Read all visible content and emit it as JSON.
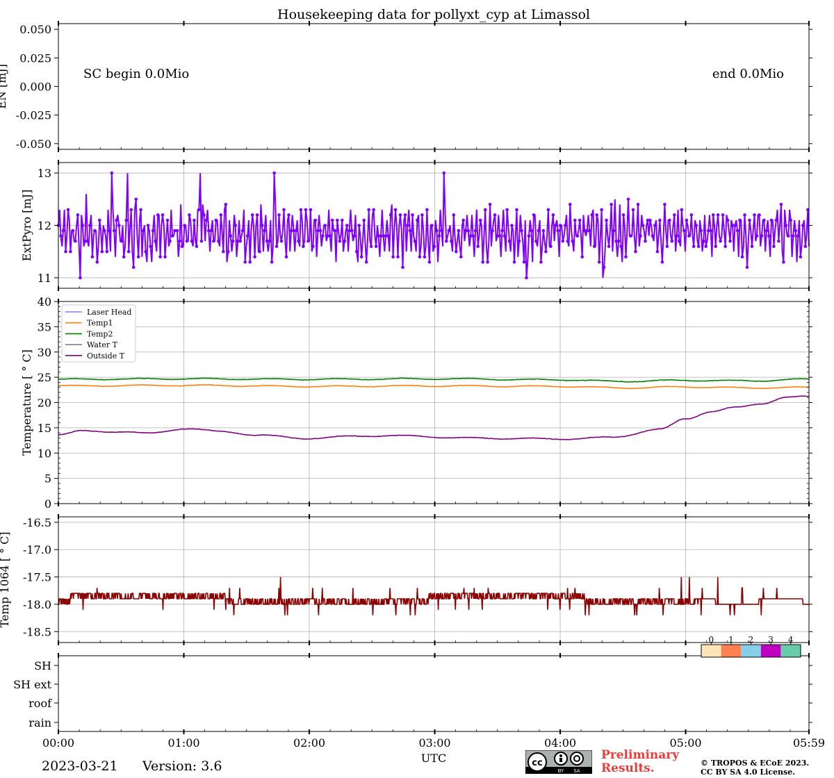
{
  "footer": {
    "date": "2023-03-21",
    "version": "Version: 3.6",
    "preliminary_line1": "Preliminary",
    "preliminary_line2": "Results.",
    "copyright_line1": "© TROPOS & ECoE 2023.",
    "copyright_line2": "CC BY SA 4.0 License.",
    "license_badge": "cc-by-sa-icon"
  },
  "chart_data": {
    "type": "line",
    "title": "Housekeeping data for pollyxt_cyp at Limassol",
    "xlabel": "UTC",
    "x_ticks": [
      "00:00",
      "01:00",
      "02:00",
      "03:00",
      "04:00",
      "05:00",
      "05:59"
    ],
    "x_range_hours": [
      0,
      5.983
    ],
    "grid": true,
    "panels": [
      {
        "id": "energy",
        "ylabel": "EN [mJ]",
        "ylim": [
          -0.055,
          0.055
        ],
        "yticks": [
          "0.050",
          "0.025",
          "0.000",
          "-0.025",
          "-0.050"
        ],
        "ytick_values": [
          0.05,
          0.025,
          0.0,
          -0.025,
          -0.05
        ],
        "annotations": [
          "SC begin 0.0Mio",
          "end 0.0Mio"
        ],
        "series": []
      },
      {
        "id": "extpyro",
        "ylabel": "ExtPyro [mJ]",
        "ylim": [
          10.8,
          13.2
        ],
        "yticks": [
          "13",
          "12",
          "11"
        ],
        "ytick_values": [
          13,
          12,
          11
        ],
        "series": [
          {
            "name": "ExtPyro",
            "color": "#7f00ff",
            "marker": "dot",
            "mean": 11.85,
            "min": 10.9,
            "max": 13.1
          }
        ]
      },
      {
        "id": "temperature",
        "ylabel": "Temperature [$^\\circ C$]",
        "ylim": [
          0,
          40
        ],
        "yticks": [
          "40",
          "35",
          "30",
          "25",
          "20",
          "15",
          "10",
          "5",
          "0"
        ],
        "ytick_values": [
          40,
          35,
          30,
          25,
          20,
          15,
          10,
          5,
          0
        ],
        "legend_position": "upper-left",
        "series": [
          {
            "name": "Laser Head",
            "color": "#7b7bff",
            "x": [],
            "y": []
          },
          {
            "name": "Temp1",
            "color": "#ff7f0e",
            "x": [
              0,
              1,
              2,
              3,
              4,
              4.5,
              5,
              5.5,
              5.98
            ],
            "y": [
              23.3,
              23.4,
              23.2,
              23.3,
              23.2,
              22.9,
              23.1,
              22.9,
              23.0
            ]
          },
          {
            "name": "Temp2",
            "color": "#008000",
            "x": [
              0,
              1,
              2,
              3,
              4,
              4.5,
              5,
              5.5,
              5.98
            ],
            "y": [
              24.6,
              24.7,
              24.6,
              24.7,
              24.5,
              24.2,
              24.4,
              24.3,
              24.6
            ]
          },
          {
            "name": "Water T",
            "color": "#808080",
            "x": [],
            "y": []
          },
          {
            "name": "Outside T",
            "color": "#800080",
            "x": [
              0,
              0.2,
              0.5,
              0.7,
              1.0,
              1.3,
              1.6,
              2.0,
              2.4,
              2.8,
              3.2,
              3.6,
              4.0,
              4.4,
              4.8,
              5.0,
              5.2,
              5.4,
              5.6,
              5.8,
              5.98
            ],
            "y": [
              13.6,
              14.4,
              14.2,
              13.9,
              14.8,
              14.3,
              13.5,
              12.9,
              13.4,
              13.4,
              13.0,
              12.9,
              12.8,
              13.1,
              14.7,
              16.8,
              18.2,
              19.0,
              19.8,
              21.0,
              21.2
            ]
          }
        ]
      },
      {
        "id": "temp1064",
        "ylabel": "Temp 1064 [$^\\circ C$]",
        "ylim": [
          -18.7,
          -16.4
        ],
        "yticks": [
          "-16.5",
          "-17.0",
          "-17.5",
          "-18.0",
          "-18.5"
        ],
        "ytick_values": [
          -16.5,
          -17.0,
          -17.5,
          -18.0,
          -18.5
        ],
        "series": [
          {
            "name": "Temp 1064",
            "color": "#8b0000",
            "step": true,
            "levels": [
              -17.8,
              -17.9,
              -18.0,
              -18.1
            ],
            "min": -18.3,
            "max": -17.5
          }
        ]
      },
      {
        "id": "status",
        "ylabel": "",
        "categories": [
          "SH",
          "SH ext",
          "roof",
          "rain"
        ],
        "colorbar_labels": [
          "0",
          "1",
          "2",
          "3",
          "4"
        ],
        "colorbar_colors": [
          "#ffe4b5",
          "#ff7f50",
          "#87ceeb",
          "#c000c0",
          "#66cdaa"
        ],
        "series": []
      }
    ]
  }
}
